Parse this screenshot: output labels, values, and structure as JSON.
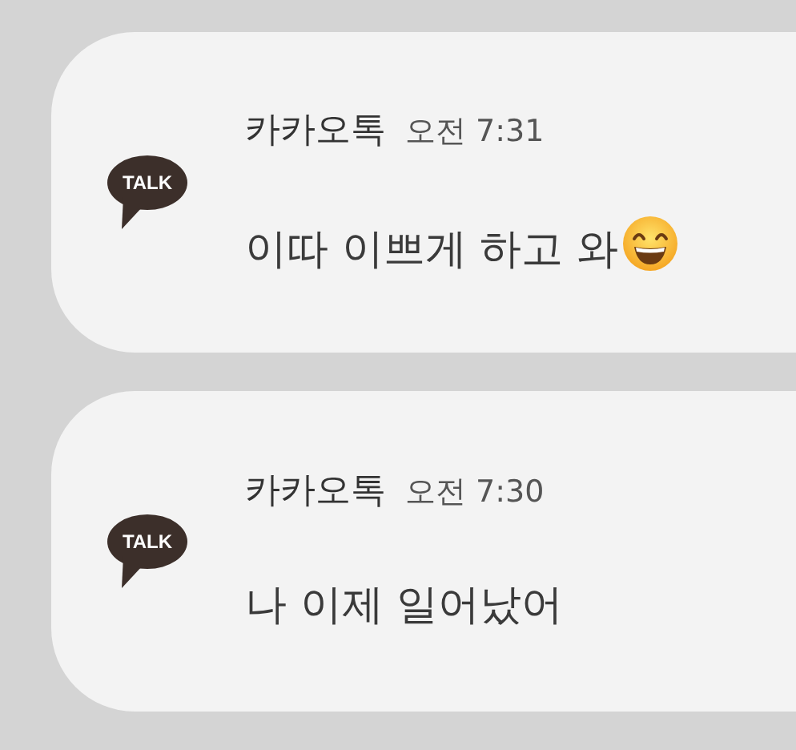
{
  "notifications": [
    {
      "logo_text": "TALK",
      "app": "카카오톡",
      "time": "오전 7:31",
      "message": "이따 이쁘게 하고 와",
      "emoji": true
    },
    {
      "logo_text": "TALK",
      "app": "카카오톡",
      "time": "오전 7:30",
      "message": "나 이제 일어났어",
      "emoji": false
    }
  ]
}
